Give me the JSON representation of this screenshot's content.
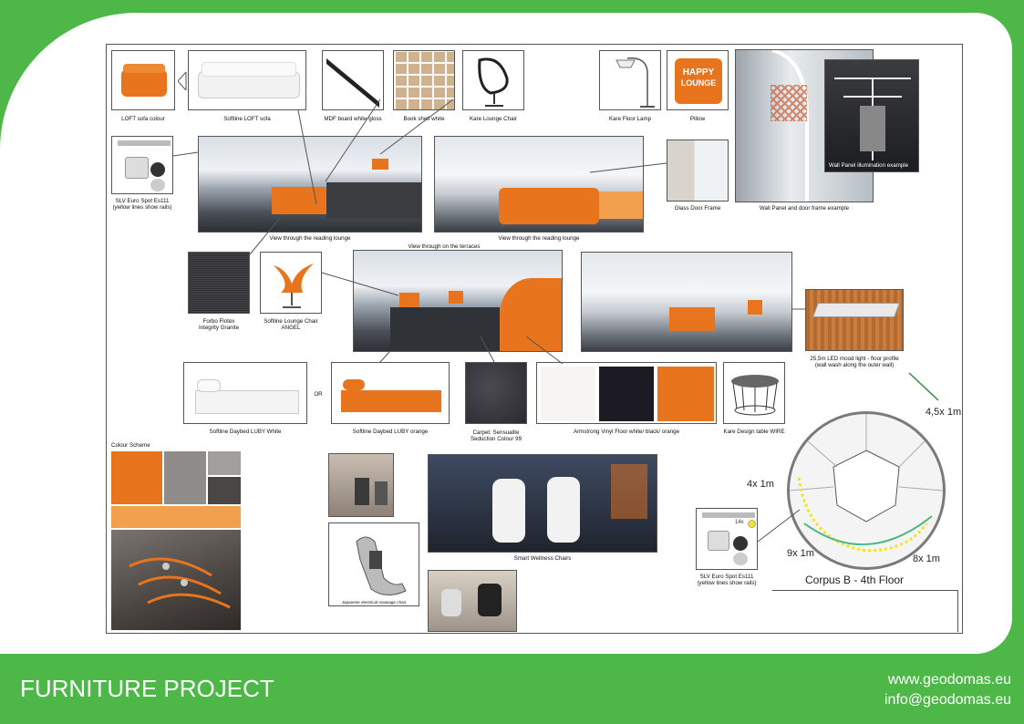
{
  "footer": {
    "title": "FURNITURE PROJECT",
    "website": "www.geodomas.eu",
    "email": "info@geodomas.eu"
  },
  "captions": {
    "loft_sofa_colour": "LOFT sofa colour",
    "softline_loft_sofa": "Softline LOFT sofa",
    "mdf_board": "MDF board white gloss",
    "book_shelf": "Book shelf white",
    "kare_lounge_chair": "Kare Lounge Chair",
    "kare_floor_lamp": "Kare Floor Lamp",
    "pillow": "Pillow",
    "pillow_text_1": "HAPPY",
    "pillow_text_2": "LOUNGE",
    "slv_spot_top_1": "SLV Euro Spot Es111",
    "slv_spot_top_2": "(yellow lines show rails)",
    "view_reading_lounge_1": "View through the reading lounge",
    "view_terraces": "View through on the terraces",
    "view_reading_lounge_2": "View through the reading lounge",
    "glass_door_frame": "Glass Door Frame",
    "wall_panel_example": "Wall Panel and door frame example",
    "wall_panel_illumination": "Wall Panel illumination example",
    "forbo_1": "Forbo Flotex",
    "forbo_2": "Integrity Granite",
    "softline_lounge_chair_1": "Softline Lounge Chair",
    "softline_lounge_chair_2": "ANGEL",
    "led_mood_1": "25,5m LED mood light - floor profile",
    "led_mood_2": "(wall wash along the outer wall)",
    "daybed_white": "Softline Daybed LUBY White",
    "or": "OR",
    "daybed_orange": "Softline Daybed LUBY orange",
    "carpet_1": "Carpet: Sensualite",
    "carpet_2": "Seduction Colour 99",
    "armstrong": "Armstrong Vinyl Floor white/ black/ orange",
    "kare_table": "Kare Design table WIRE",
    "colour_scheme": "Colour Scheme",
    "smart_wellness": "Smart Wellness Chairs",
    "japanese_massage": "Japanese electrical massage chair",
    "slv_spot_bottom_1": "SLV Euro Spot Es111",
    "slv_spot_bottom_2": "(yellow lines show rails)",
    "spot_count": "14x"
  },
  "floorplan": {
    "title": "Corpus B  -  4th Floor",
    "dim_top_right": "4,5x 1m",
    "dim_left": "4x 1m",
    "dim_bottom_left": "9x 1m",
    "dim_bottom_right": "8x 1m"
  },
  "colors": {
    "brand_green": "#4db848",
    "orange": "#e8741e",
    "light_orange": "#f2a04d",
    "grey": "#8f8c8a",
    "dark_grey": "#4a4646",
    "black": "#1c1b24"
  }
}
